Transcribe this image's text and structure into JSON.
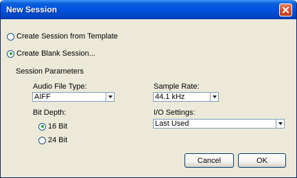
{
  "window": {
    "title": "New Session"
  },
  "options": {
    "from_template": "Create Session from Template",
    "blank": "Create Blank Session...",
    "selected": "blank"
  },
  "params": {
    "section_title": "Session Parameters",
    "audio_file_type": {
      "label": "Audio File Type:",
      "value": "AIFF"
    },
    "sample_rate": {
      "label": "Sample Rate:",
      "value": "44.1 kHz"
    },
    "bit_depth": {
      "label": "Bit Depth:",
      "options": [
        "16 Bit",
        "24 Bit"
      ],
      "selected": "16 Bit"
    },
    "io_settings": {
      "label": "I/O Settings:",
      "value": "Last Used"
    }
  },
  "buttons": {
    "cancel": "Cancel",
    "ok": "OK"
  },
  "icons": {
    "close": "close-icon",
    "dropdown": "chevron-down-icon"
  },
  "colors": {
    "titlebar": "#0054e3",
    "dialog_bg": "#ece9d8",
    "radio_dot": "#21a121",
    "close_button": "#d8512c",
    "field_border": "#7f9db9"
  }
}
